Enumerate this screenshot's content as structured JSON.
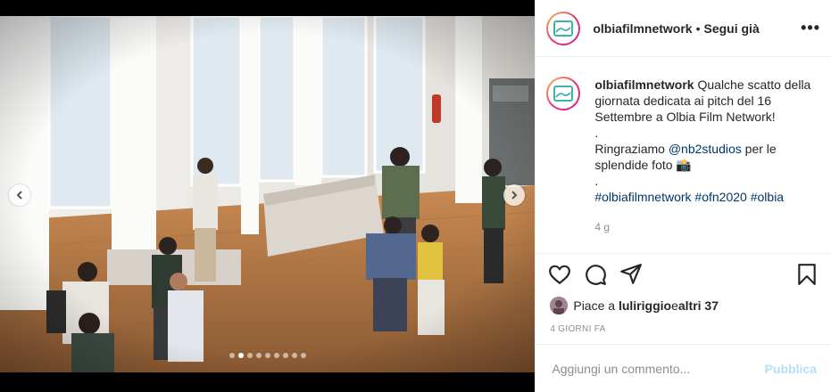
{
  "post": {
    "username": "olbiafilmnetwork",
    "separator": "•",
    "follow_status": "Segui già",
    "more": "•••",
    "caption": {
      "line1": "Qualche scatto della giornata dedicata ai pitch del 16 Settembre a Olbia Film Network!",
      "line2": ".",
      "line3_prefix": "Ringraziamo ",
      "mention": "@nb2studios",
      "line3_suffix": " per le splendide foto 📸",
      "line4": ".",
      "hashtags": [
        "#olbiafilmnetwork",
        "#ofn2020",
        "#olbia"
      ]
    },
    "caption_age": "4 g",
    "likes": {
      "prefix": "Piace a ",
      "user": "luliriggio",
      "middle": " e ",
      "others": "altri 37"
    },
    "posted_ago": "4 GIORNI FA",
    "comment": {
      "placeholder": "Aggiungi un commento...",
      "publish_label": "Pubblica"
    }
  },
  "carousel": {
    "total": 9,
    "active_index": 1
  },
  "colors": {
    "link": "#00376b",
    "muted": "#8e8e8e",
    "publish_disabled": "#b2dffc",
    "ring_start": "#f9c25d",
    "ring_end": "#d21f8f"
  },
  "icons": [
    "heart-icon",
    "comment-icon",
    "share-icon",
    "bookmark-icon",
    "chevron-left-icon",
    "chevron-right-icon",
    "more-icon"
  ]
}
